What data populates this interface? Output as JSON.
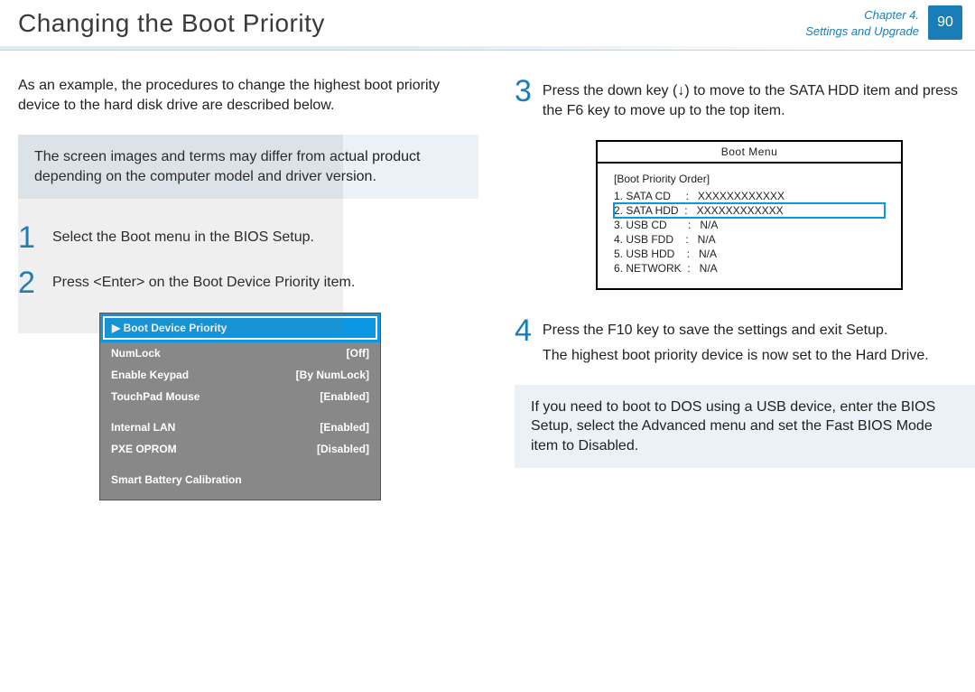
{
  "header": {
    "title": "Changing the Boot Priority",
    "chapter_line1": "Chapter 4.",
    "chapter_line2": "Settings and Upgrade",
    "page_number": "90"
  },
  "left": {
    "intro": "As an example, the procedures to change the highest boot priority device to the hard disk drive are described below.",
    "note": "The screen images and terms may differ from actual product depending on the computer model and driver version.",
    "step1_num": "1",
    "step1_text_a": "Select the ",
    "step1_text_b": "Boot",
    "step1_text_c": " menu in the BIOS Setup.",
    "step2_num": "2",
    "step2_text_a": "Press <",
    "step2_text_b": "Enter",
    "step2_text_c": "> on the ",
    "step2_text_d": "Boot Device Priority",
    "step2_text_e": " item.",
    "bios": {
      "selected": "▶ Boot Device Priority",
      "rows": [
        {
          "label": "NumLock",
          "value": "[Off]"
        },
        {
          "label": "Enable Keypad",
          "value": "[By NumLock]"
        },
        {
          "label": "TouchPad Mouse",
          "value": "[Enabled]"
        }
      ],
      "rows2": [
        {
          "label": "Internal LAN",
          "value": "[Enabled]"
        },
        {
          "label": "PXE OPROM",
          "value": "[Disabled]"
        }
      ],
      "footer": "Smart Battery Calibration"
    }
  },
  "right": {
    "step3_num": "3",
    "step3_a": "Press the down key ",
    "step3_arrow": "(↓)",
    "step3_b": " to move to the ",
    "step3_c": "SATA HDD",
    "step3_d": " item and press the ",
    "step3_e": "F6",
    "step3_f": " key to move up to the top item.",
    "bootmenu": {
      "title": "Boot Menu",
      "section": "[Boot Priority Order]",
      "items": [
        {
          "text": "1. SATA CD     :   XXXXXXXXXXXX",
          "hl": false
        },
        {
          "text": "2. SATA HDD  :   XXXXXXXXXXXX",
          "hl": true
        },
        {
          "text": "3. USB CD       :   N/A",
          "hl": false
        },
        {
          "text": "4. USB FDD    :   N/A",
          "hl": false
        },
        {
          "text": "5. USB HDD    :   N/A",
          "hl": false
        },
        {
          "text": "6. NETWORK  :   N/A",
          "hl": false
        }
      ]
    },
    "step4_num": "4",
    "step4_a": "Press the ",
    "step4_b": "F10",
    "step4_c": " key to save the settings and exit Setup.",
    "step4_line2": "The highest boot priority device is now set to the Hard Drive.",
    "note2_a": "If you need to boot to ",
    "note2_b": "DOS",
    "note2_c": " using a ",
    "note2_d": "USB",
    "note2_e": " device, enter the BIOS Setup, select the ",
    "note2_f": "Advanced",
    "note2_g": " menu and set the ",
    "note2_h": "Fast BIOS Mode",
    "note2_i": " item to ",
    "note2_j": "Disabled",
    "note2_k": "."
  }
}
